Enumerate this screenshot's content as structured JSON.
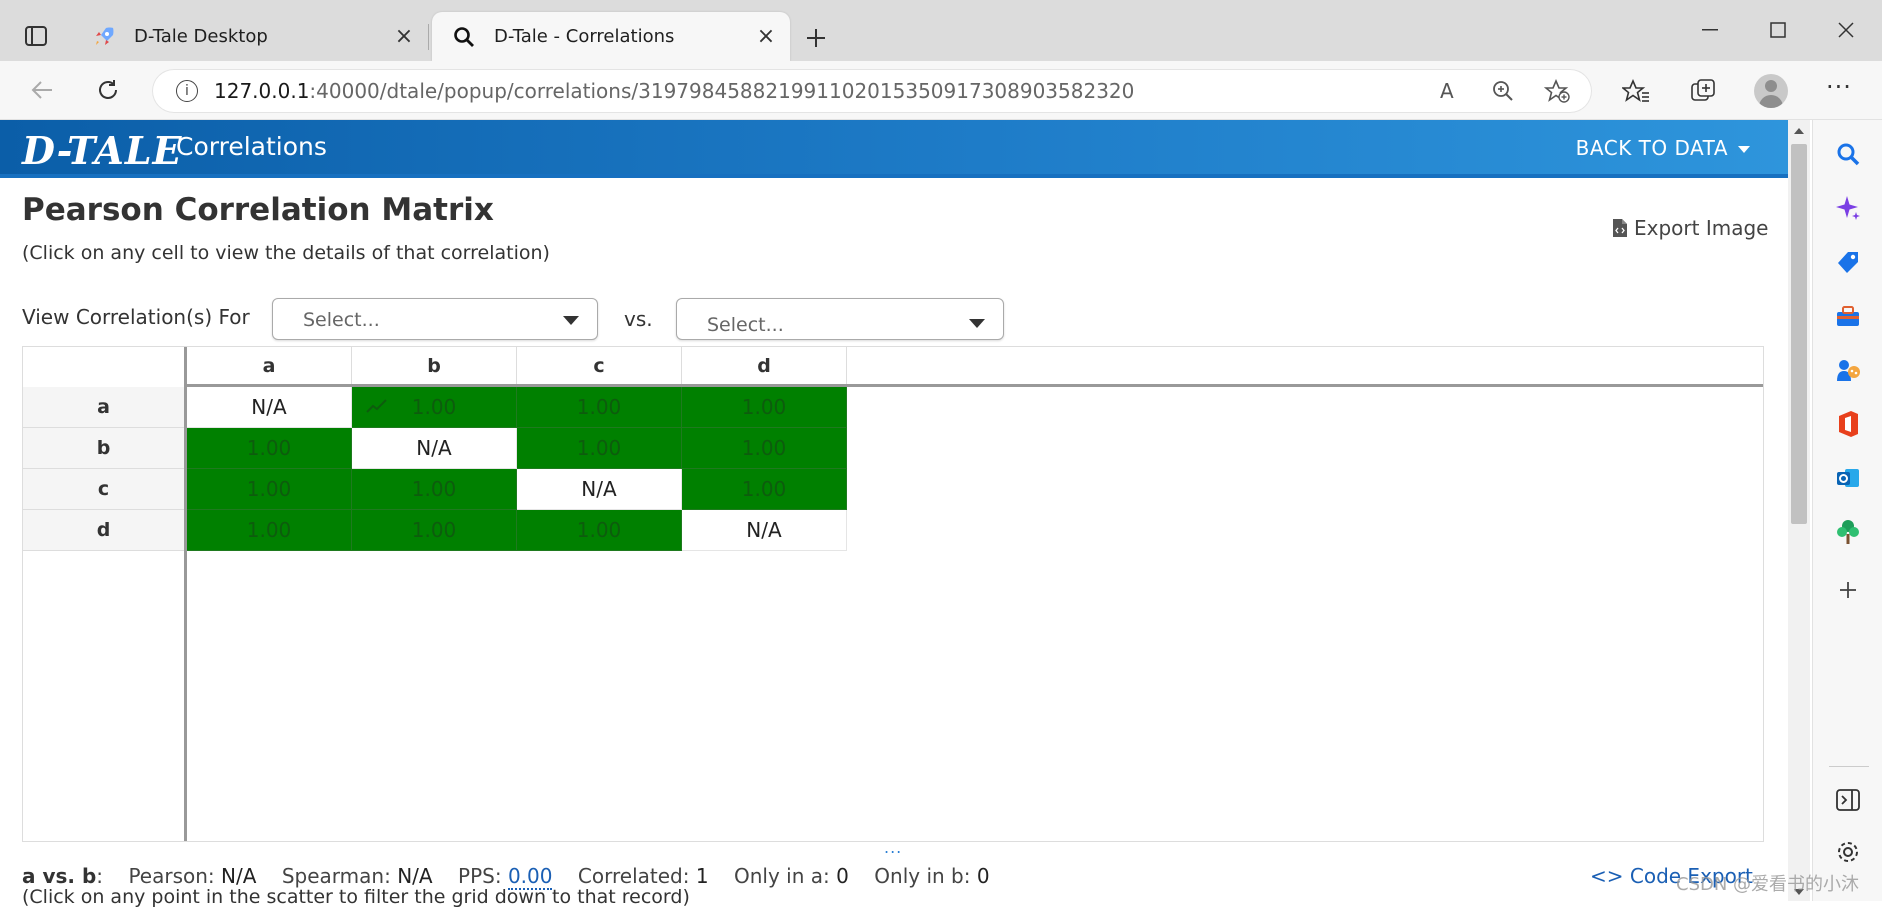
{
  "browser": {
    "tabs": [
      {
        "label": "D-Tale Desktop",
        "icon": "rocket-icon",
        "active": false
      },
      {
        "label": "D-Tale - Correlations",
        "icon": "search-icon",
        "active": true
      }
    ],
    "url_host": "127.0.0.1",
    "url_path": ":40000/dtale/popup/correlations/3197984588219911020153509173089035823​20"
  },
  "app": {
    "logo": "D-TALE",
    "title": "Correlations",
    "back_label": "BACK TO DATA"
  },
  "page": {
    "title": "Pearson Correlation Matrix",
    "subtitle": "(Click on any cell to view the details of that correlation)",
    "export_label": "Export Image",
    "view_for_label": "View Correlation(s) For",
    "select1_placeholder": "Select...",
    "vs_label": "vs.",
    "select2_placeholder": "Select..."
  },
  "matrix": {
    "columns": [
      "a",
      "b",
      "c",
      "d"
    ],
    "rows": [
      {
        "label": "a",
        "cells": [
          "N/A",
          "1.00",
          "1.00",
          "1.00"
        ]
      },
      {
        "label": "b",
        "cells": [
          "1.00",
          "N/A",
          "1.00",
          "1.00"
        ]
      },
      {
        "label": "c",
        "cells": [
          "1.00",
          "1.00",
          "N/A",
          "1.00"
        ]
      },
      {
        "label": "d",
        "cells": [
          "1.00",
          "1.00",
          "1.00",
          "N/A"
        ]
      }
    ],
    "high_color": "#008000"
  },
  "footer": {
    "drag_handle": "...",
    "pair_label": "a vs. b",
    "pearson_label": "Pearson:",
    "pearson_value": "N/A",
    "spearman_label": "Spearman:",
    "spearman_value": "N/A",
    "pps_label": "PPS:",
    "pps_value": "0.00",
    "correlated_label": "Correlated:",
    "correlated_value": "1",
    "only_a_label": "Only in a:",
    "only_a_value": "0",
    "only_b_label": "Only in b:",
    "only_b_value": "0",
    "code_export_label": "Code Export",
    "scatter_hint": "(Click on any point in the scatter to filter the grid down to that record)",
    "watermark": "CSDN @爱看书的小沐"
  }
}
